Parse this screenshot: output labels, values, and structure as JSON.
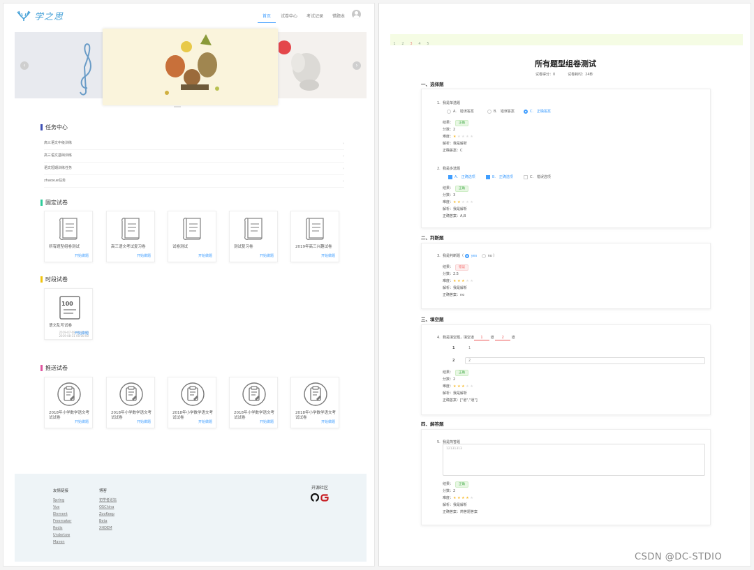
{
  "nav": {
    "brand": "学之思",
    "items": [
      "首页",
      "试卷中心",
      "考试记录",
      "错题本"
    ]
  },
  "tasks": {
    "title": "任务中心",
    "items": [
      "高三语文中级训练",
      "高三语文基础训练",
      "语文短期训练任务",
      "zhaoxue任务"
    ]
  },
  "fixed": {
    "title": "固定试卷",
    "cards": [
      {
        "name": "所有题型组卷测试",
        "action": "开始做题"
      },
      {
        "name": "高三语文考试复习卷",
        "action": "开始做题"
      },
      {
        "name": "试卷测试",
        "action": "开始做题"
      },
      {
        "name": "测试复习卷",
        "action": "开始做题"
      },
      {
        "name": "2019年高三兴趣试卷",
        "action": "开始做题"
      }
    ]
  },
  "timed": {
    "title": "时段试卷",
    "card": {
      "name": "语文乱写试卷",
      "date_start": "2019-07-08 00:00:00",
      "date_end": "2019-08-31 00:00:00",
      "action": "开始做题",
      "icon_text": "100"
    }
  },
  "pushed": {
    "title": "推送试卷",
    "cards": [
      {
        "name": "2018年小学数学语文考试试卷",
        "action": "开始做题"
      },
      {
        "name": "2018年小学数学语文考试试卷",
        "action": "开始做题"
      },
      {
        "name": "2018年小学数学语文考试试卷",
        "action": "开始做题"
      },
      {
        "name": "2018年小学数学语文考试试卷",
        "action": "开始做题"
      },
      {
        "name": "2018年小学数学语文考试试卷",
        "action": "开始做题"
      }
    ]
  },
  "footer": {
    "links_title": "友情链接",
    "links": [
      "Spring",
      "Vue",
      "Element",
      "Freemaker",
      "Redis",
      "Undertow",
      "Maven"
    ],
    "blog_title": "博客",
    "blogs": [
      "初学者论坛",
      "OSChina",
      "ZooKeep",
      "Beta",
      "XHDEM"
    ],
    "open_title": "开源社区"
  },
  "exam": {
    "pager": [
      "1",
      "2",
      "3",
      "4",
      "5"
    ],
    "title": "所有题型组卷测试",
    "score_label": "试卷得分：0",
    "time_label": "试卷耗时：24秒",
    "sections": [
      "一、选择题",
      "二、判断题",
      "三、填空题",
      "四、解答题"
    ],
    "labels": {
      "result": "结果：",
      "score": "分数：",
      "difficulty": "难度：",
      "analysis": "解析：",
      "answer": "正确答案："
    },
    "q1": {
      "num": "1.",
      "title": "我是单选题",
      "options": [
        "A.",
        "错误答案",
        "B.",
        "错误答案",
        "C.",
        "正确答案"
      ],
      "result": "正确",
      "score": "2",
      "difficulty": 1,
      "analysis": "我是解析",
      "answer": "C"
    },
    "q2": {
      "num": "2.",
      "title": "我是多选题",
      "options": [
        "A.",
        "正确选项",
        "B.",
        "正确选项",
        "C.",
        "错误选项"
      ],
      "result": "正确",
      "score": "3",
      "difficulty": 2,
      "analysis": "我是解析",
      "answer": "A,B"
    },
    "q3": {
      "num": "3.",
      "title": "我是判断题（",
      "yes": "yes",
      "no": "no",
      "close": "）",
      "result": "错误",
      "score": "2.5",
      "difficulty": 3,
      "analysis": "我是解析",
      "answer": "no"
    },
    "q4": {
      "num": "4.",
      "title": "我是填空题，填空道",
      "blank1": "1",
      "mid": "道",
      "blank2": "2",
      "end": "道",
      "input1_label": "1",
      "input1_value": "1",
      "input2_label": "2",
      "input2_value": "2",
      "result": "正确",
      "score": "2",
      "difficulty": 3,
      "analysis": "我是解析",
      "answer": "[\"道\",\"道\"]"
    },
    "q5": {
      "num": "5.",
      "title": "我是简答题",
      "value": "12131313",
      "result": "正确",
      "score": "2",
      "difficulty": 4,
      "analysis": "我是解析",
      "answer": "简答题答案"
    }
  },
  "watermark": "CSDN @DC-STDIO"
}
